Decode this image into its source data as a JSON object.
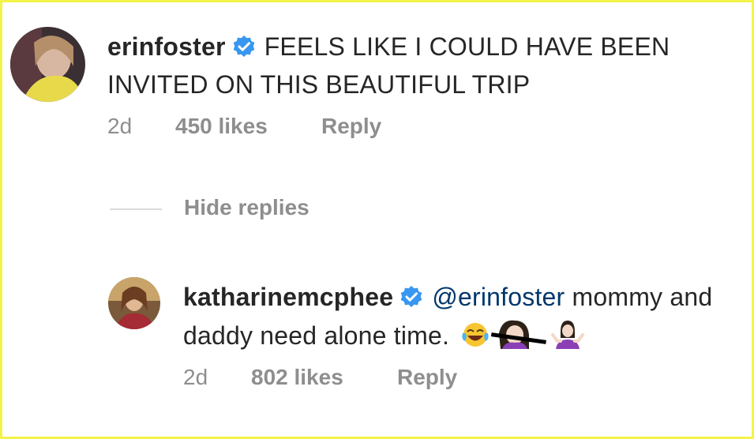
{
  "comments": [
    {
      "username": "erinfoster",
      "verified": true,
      "text": "FEELS LIKE I COULD HAVE BEEN INVITED ON THIS BEAUTIFUL TRIP",
      "age": "2d",
      "likes": "450 likes",
      "reply_label": "Reply"
    },
    {
      "username": "katharinemcphee",
      "verified": true,
      "mention": "@erinfoster",
      "text": "mommy and daddy need alone time.",
      "emojis": [
        "face-with-tears-of-joy-icon",
        "woman-facepalming-icon",
        "woman-shrugging-icon"
      ],
      "age": "2d",
      "likes": "802 likes",
      "reply_label": "Reply"
    }
  ],
  "hide_replies_label": "Hide replies",
  "colors": {
    "text": "#262626",
    "muted": "#8e8e8e",
    "mention": "#00376b",
    "verified": "#3897f0",
    "frame": "#f3f34a"
  }
}
